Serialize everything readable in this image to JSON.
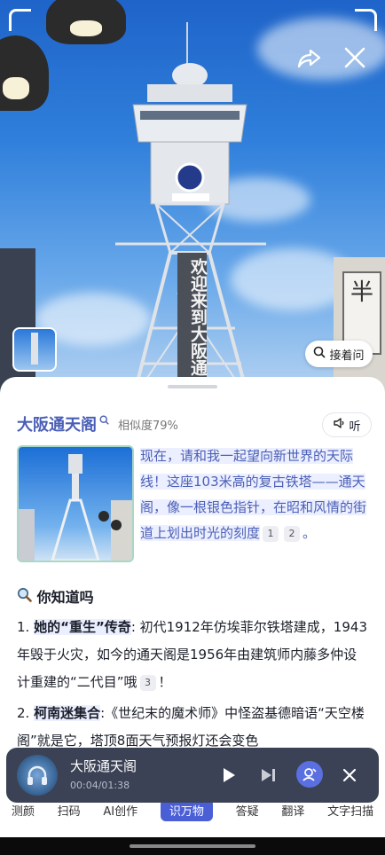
{
  "photo": {
    "banner_text": "欢迎来到大阪通天",
    "sign_text": "半"
  },
  "actions": {
    "ask_label": "接着问"
  },
  "result": {
    "title": "大阪通天阁",
    "similarity": "相似度79%",
    "listen_label": "听",
    "lead_text": "现在，请和我一起望向新世界的天际线！这座103米高的复古铁塔——通天阁，像一根银色指针，在昭和风情的街道上划出时光的刻度",
    "lead_refs": [
      "1",
      "2"
    ],
    "lead_end": "。"
  },
  "section": {
    "heading": "你知道吗"
  },
  "facts": [
    {
      "num": "1. ",
      "bold": "她的“重生”传奇",
      "text": ": 初代1912年仿埃菲尔铁塔建成，1943年毁于火灾，如今的通天阁是1956年由建筑师内藤多仲设计重建的“二代目”哦",
      "ref": "3",
      "end": "！"
    },
    {
      "num": "2. ",
      "bold": "柯南迷集合",
      "text": ":《世纪末的魔术师》中怪盗基德暗语“天空楼阁”就是它，塔顶8面天气预报灯还会变色"
    }
  ],
  "player": {
    "title": "大阪通天阁",
    "time": "00:04/01:38"
  },
  "tabs": [
    {
      "label": "测颜"
    },
    {
      "label": "扫码"
    },
    {
      "label": "AI创作"
    },
    {
      "label": "识万物",
      "active": true
    },
    {
      "label": "答疑"
    },
    {
      "label": "翻译"
    },
    {
      "label": "文字扫描"
    }
  ],
  "colors": {
    "accent": "#4a5fb6",
    "tab_active": "#4a5fd6",
    "player_bg": "#3b4255",
    "sky": "#2f7fdb"
  },
  "icons": [
    "share-icon",
    "close-icon",
    "search-icon",
    "speaker-icon",
    "magnifier-icon",
    "headphones-icon",
    "play-icon",
    "next-icon",
    "ai-assistant-icon"
  ]
}
